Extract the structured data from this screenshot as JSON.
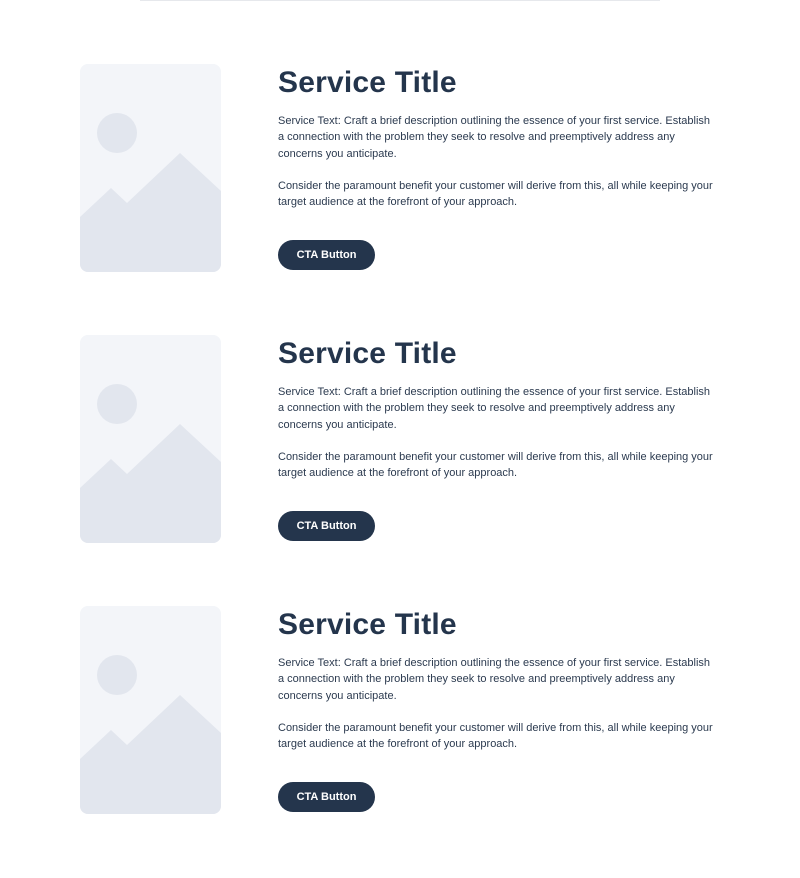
{
  "colors": {
    "heading": "#24354c",
    "body_text": "#2b3a4f",
    "button_bg": "#24354c",
    "button_text": "#ffffff",
    "placeholder_bg": "#f3f5f9",
    "placeholder_shape": "#e2e6ee"
  },
  "services": [
    {
      "image_icon": "image-placeholder-icon",
      "title": "Service Title",
      "text_1": "Service Text: Craft a brief description outlining the essence of your first service. Establish a connection with the problem they seek to resolve and preemptively address any concerns you anticipate.",
      "text_2": "Consider the paramount benefit your customer will derive from this, all while keeping your target audience at the forefront of your approach.",
      "cta_label": "CTA Button"
    },
    {
      "image_icon": "image-placeholder-icon",
      "title": "Service Title",
      "text_1": "Service Text: Craft a brief description outlining the essence of your first service. Establish a connection with the problem they seek to resolve and preemptively address any concerns you anticipate.",
      "text_2": "Consider the paramount benefit your customer will derive from this, all while keeping your target audience at the forefront of your approach.",
      "cta_label": "CTA Button"
    },
    {
      "image_icon": "image-placeholder-icon",
      "title": "Service Title",
      "text_1": "Service Text: Craft a brief description outlining the essence of your first service. Establish a connection with the problem they seek to resolve and preemptively address any concerns you anticipate.",
      "text_2": "Consider the paramount benefit your customer will derive from this, all while keeping your target audience at the forefront of your approach.",
      "cta_label": "CTA Button"
    }
  ]
}
